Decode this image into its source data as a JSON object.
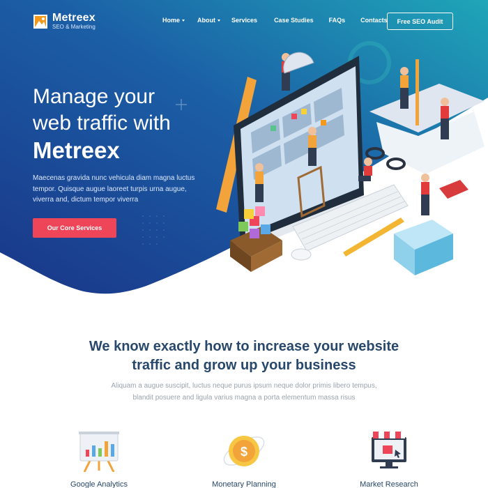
{
  "nav": {
    "brand_name": "Metreex",
    "brand_tagline": "SEO & Marketing",
    "items": [
      {
        "label": "Home",
        "has_caret": true
      },
      {
        "label": "About",
        "has_caret": true
      },
      {
        "label": "Services",
        "has_caret": false
      },
      {
        "label": "Case Studies",
        "has_caret": false
      },
      {
        "label": "FAQs",
        "has_caret": false
      },
      {
        "label": "Contacts",
        "has_caret": false
      }
    ],
    "cta_label": "Free SEO Audit"
  },
  "hero": {
    "title_line1": "Manage your",
    "title_line2": "web traffic with",
    "title_brand": "Metreex",
    "description": "Maecenas gravida nunc vehicula diam magna luctus tempor. Quisque augue laoreet turpis urna augue, viverra and, dictum tempor viverra",
    "button_label": "Our Core Services"
  },
  "section": {
    "title_line1": "We know exactly how to increase your website",
    "title_line2": "traffic and grow up your business",
    "description_line1": "Aliquam a augue suscipit, luctus neque purus ipsum neque dolor primis libero tempus,",
    "description_line2": "blandit posuere and ligula varius magna a porta elementum massa risus"
  },
  "features": [
    {
      "label": "Google Analytics",
      "icon": "analytics-easel-icon"
    },
    {
      "label": "Monetary Planning",
      "icon": "dollar-coin-icon"
    },
    {
      "label": "Market Research",
      "icon": "shop-monitor-icon"
    }
  ],
  "colors": {
    "hero_gradient_start": "#1b3f94",
    "hero_gradient_end": "#1ea3b6",
    "accent_button": "#ee4558",
    "heading": "#27476b",
    "body_text": "#9aa3ad"
  }
}
